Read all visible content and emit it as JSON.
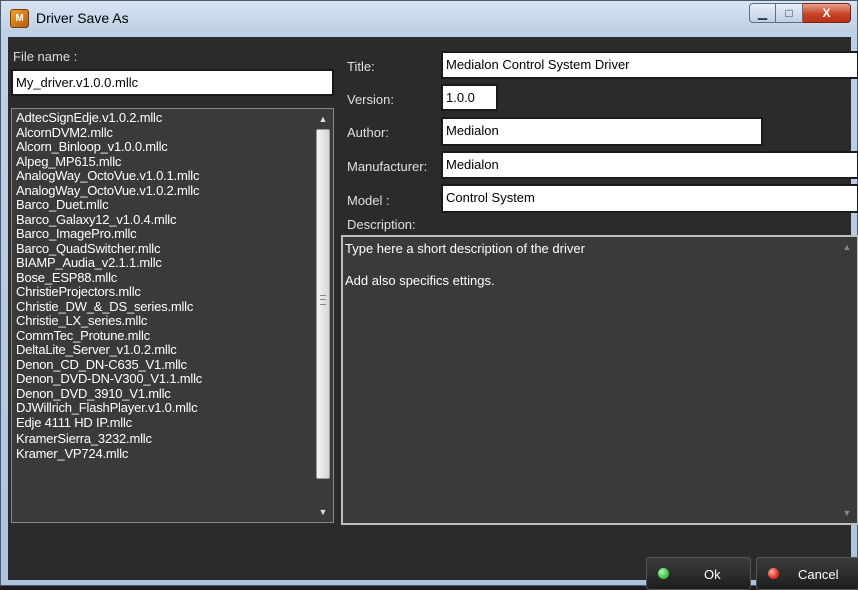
{
  "window": {
    "title": "Driver Save As",
    "app_icon": "mediaplayer-app-icon"
  },
  "controls": {
    "minimize": "▁",
    "maximize": "□",
    "close": "X"
  },
  "file": {
    "label": "File name :",
    "value": "My_driver.v1.0.0.mllc",
    "list": [
      "AdtecSignEdje.v1.0.2.mllc",
      "AlcornDVM2.mllc",
      "Alcorn_Binloop_v1.0.0.mllc",
      "Alpeg_MP615.mllc",
      "AnalogWay_OctoVue.v1.0.1.mllc",
      "AnalogWay_OctoVue.v1.0.2.mllc",
      "Barco_Duet.mllc",
      "Barco_Galaxy12_v1.0.4.mllc",
      "Barco_ImagePro.mllc",
      "Barco_QuadSwitcher.mllc",
      "BIAMP_Audia_v2.1.1.mllc",
      "Bose_ESP88.mllc",
      "ChristieProjectors.mllc",
      "Christie_DW_&_DS_series.mllc",
      "Christie_LX_series.mllc",
      "CommTec_Protune.mllc",
      "DeltaLite_Server_v1.0.2.mllc",
      "Denon_CD_DN-C635_V1.mllc",
      "Denon_DVD-DN-V300_V1.1.mllc",
      "Denon_DVD_3910_V1.mllc",
      "DJWillrich_FlashPlayer.v1.0.mllc",
      "Edje 4111 HD IP.mllc",
      "KramerSierra_3232.mllc",
      "Kramer_VP724.mllc"
    ]
  },
  "form": {
    "title": {
      "label": "Title:",
      "value": "Medialon Control System Driver"
    },
    "version": {
      "label": "Version:",
      "value": "1.0.0"
    },
    "author": {
      "label": "Author:",
      "value": "Medialon"
    },
    "manufacturer": {
      "label": "Manufacturer:",
      "value": "Medialon"
    },
    "model": {
      "label": "Model :",
      "value": "Control System"
    },
    "description": {
      "label": "Description:",
      "line1": "Type here a short description of the driver",
      "line2": "Add also specifics ettings."
    }
  },
  "buttons": {
    "ok": "Ok",
    "cancel": "Cancel"
  },
  "colors": {
    "ok_dot": "#3cc63c",
    "cancel_dot": "#e0321e"
  }
}
